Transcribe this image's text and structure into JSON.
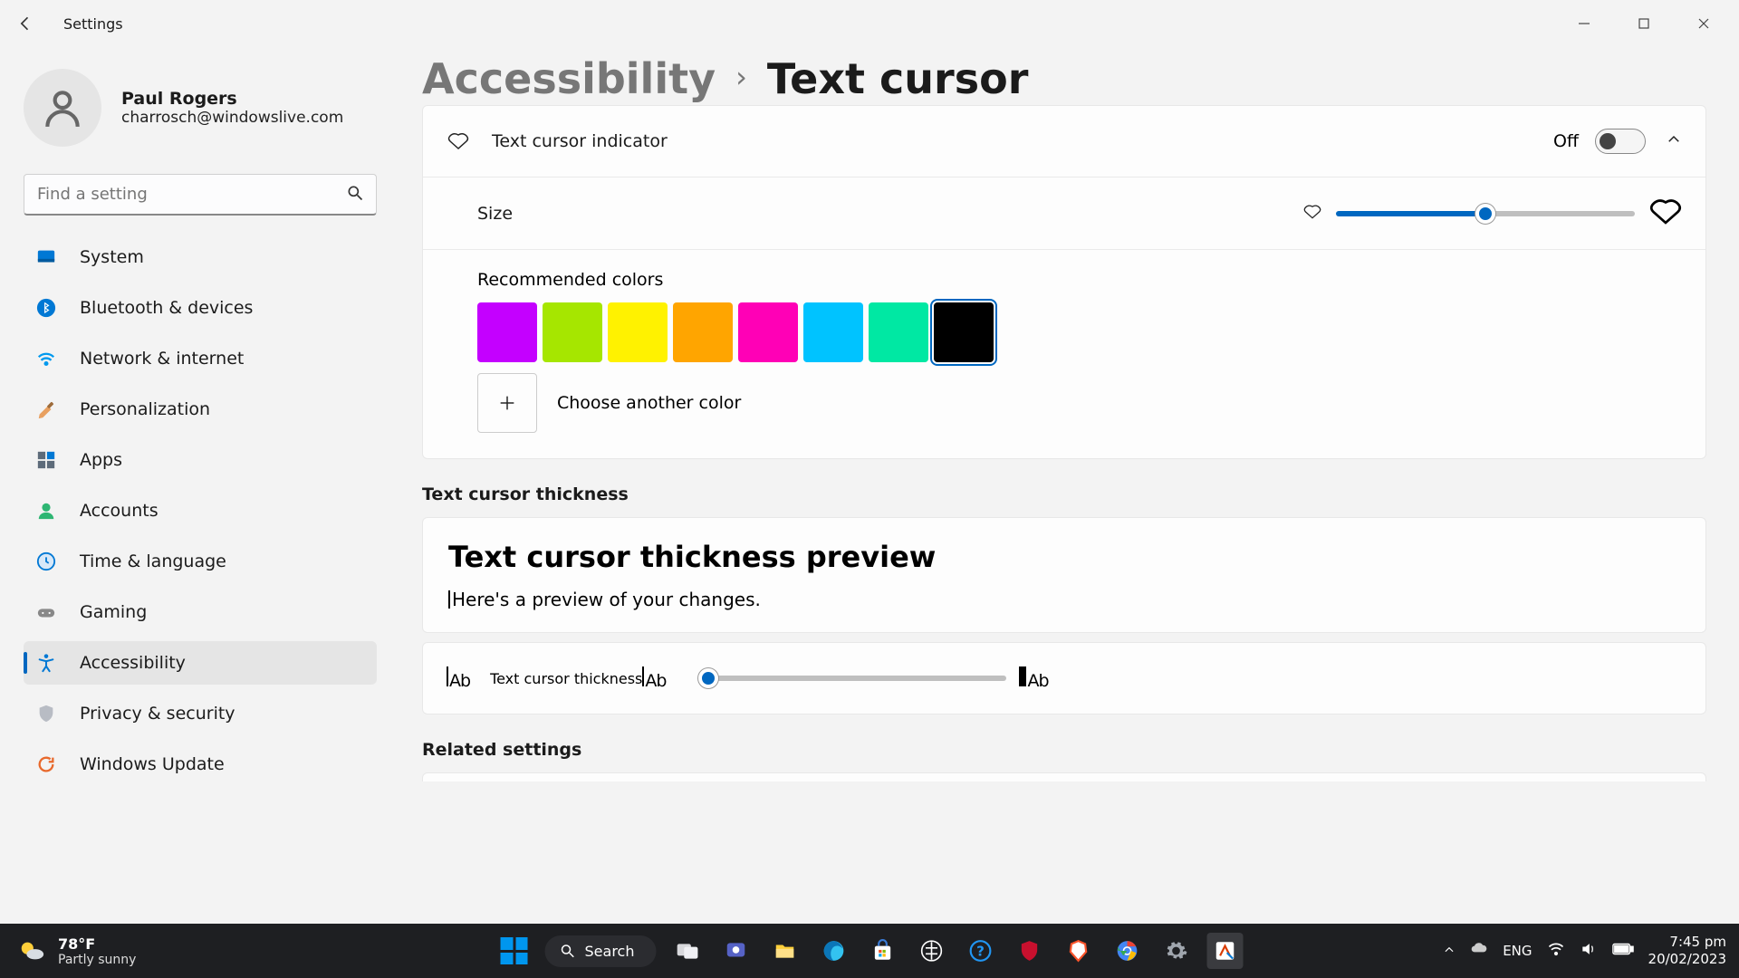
{
  "window": {
    "title": "Settings"
  },
  "profile": {
    "name": "Paul Rogers",
    "email": "charrosch@windowslive.com"
  },
  "search": {
    "placeholder": "Find a setting"
  },
  "nav": {
    "items": [
      {
        "label": "System"
      },
      {
        "label": "Bluetooth & devices"
      },
      {
        "label": "Network & internet"
      },
      {
        "label": "Personalization"
      },
      {
        "label": "Apps"
      },
      {
        "label": "Accounts"
      },
      {
        "label": "Time & language"
      },
      {
        "label": "Gaming"
      },
      {
        "label": "Accessibility"
      },
      {
        "label": "Privacy & security"
      },
      {
        "label": "Windows Update"
      }
    ],
    "active_index": 8
  },
  "breadcrumb": {
    "parent": "Accessibility",
    "current": "Text cursor"
  },
  "indicator": {
    "label": "Text cursor indicator",
    "state_label": "Off",
    "size_label": "Size",
    "size_value": 50,
    "colors_label": "Recommended colors",
    "colors": [
      "#c400ff",
      "#a6e600",
      "#fff200",
      "#ffa500",
      "#ff00b6",
      "#00c3ff",
      "#00e8a3",
      "#000000"
    ],
    "selected_color_index": 7,
    "choose_label": "Choose another color"
  },
  "thickness": {
    "section": "Text cursor thickness",
    "preview_title": "Text cursor thickness preview",
    "preview_text": "Here's a preview of your changes.",
    "row_label": "Text cursor thickness",
    "value": 1
  },
  "related": {
    "section": "Related settings"
  },
  "taskbar": {
    "weather": {
      "temp": "78°F",
      "desc": "Partly sunny"
    },
    "search": "Search",
    "lang": "ENG",
    "time": "7:45 pm",
    "date": "20/02/2023"
  }
}
